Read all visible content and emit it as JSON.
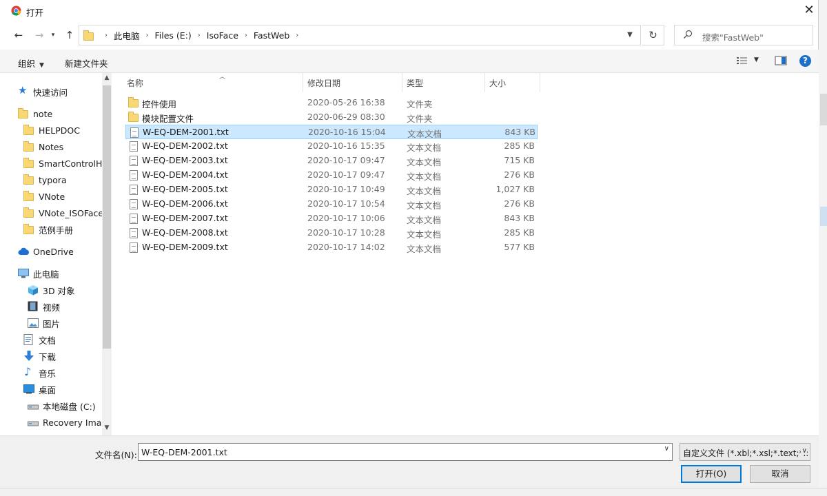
{
  "window": {
    "title": "打开",
    "close_glyph": "✕"
  },
  "address": {
    "crumbs": [
      "此电脑",
      "Files (E:)",
      "IsoFace",
      "FastWeb"
    ],
    "search_placeholder": "搜索\"FastWeb\""
  },
  "toolbar": {
    "organize": "组织",
    "new_folder": "新建文件夹"
  },
  "nav": {
    "items": [
      {
        "label": "快速访问",
        "icon": "star-icon",
        "indent": 0
      },
      {
        "label": "note",
        "icon": "folder-icon",
        "indent": 0
      },
      {
        "label": "HELPDOC",
        "icon": "folder-icon",
        "indent": 1
      },
      {
        "label": "Notes",
        "icon": "folder-icon",
        "indent": 1
      },
      {
        "label": "SmartControlH",
        "icon": "folder-icon",
        "indent": 1
      },
      {
        "label": "typora",
        "icon": "folder-icon",
        "indent": 1
      },
      {
        "label": "VNote",
        "icon": "folder-icon",
        "indent": 1
      },
      {
        "label": "VNote_ISOFace",
        "icon": "folder-icon",
        "indent": 1
      },
      {
        "label": "范例手册",
        "icon": "folder-icon",
        "indent": 1
      },
      {
        "label": "OneDrive",
        "icon": "cloud-icon",
        "indent": 0
      },
      {
        "label": "此电脑",
        "icon": "computer-icon",
        "indent": 0
      },
      {
        "label": "3D 对象",
        "icon": "cube-icon",
        "indent": 1
      },
      {
        "label": "视频",
        "icon": "film-icon",
        "indent": 1
      },
      {
        "label": "图片",
        "icon": "picture-icon",
        "indent": 1
      },
      {
        "label": "文档",
        "icon": "document-icon",
        "indent": 1
      },
      {
        "label": "下载",
        "icon": "download-arrow-icon",
        "indent": 1
      },
      {
        "label": "音乐",
        "icon": "music-note-icon",
        "indent": 1
      },
      {
        "label": "桌面",
        "icon": "desktop-icon",
        "indent": 1
      },
      {
        "label": "本地磁盘 (C:)",
        "icon": "drive-icon",
        "indent": 1
      },
      {
        "label": "Recovery Imag",
        "icon": "drive-icon",
        "indent": 1
      }
    ]
  },
  "columns": {
    "name": "名称",
    "date": "修改日期",
    "type": "类型",
    "size": "大小"
  },
  "files": [
    {
      "name": "控件使用",
      "date": "2020-05-26 16:38",
      "type": "文件夹",
      "size": "",
      "kind": "folder"
    },
    {
      "name": "模块配置文件",
      "date": "2020-06-29 08:30",
      "type": "文件夹",
      "size": "",
      "kind": "folder"
    },
    {
      "name": "W-EQ-DEM-2001.txt",
      "date": "2020-10-16 15:04",
      "type": "文本文档",
      "size": "843 KB",
      "kind": "doc",
      "selected": true
    },
    {
      "name": "W-EQ-DEM-2002.txt",
      "date": "2020-10-16 15:35",
      "type": "文本文档",
      "size": "285 KB",
      "kind": "doc"
    },
    {
      "name": "W-EQ-DEM-2003.txt",
      "date": "2020-10-17 09:47",
      "type": "文本文档",
      "size": "715 KB",
      "kind": "doc"
    },
    {
      "name": "W-EQ-DEM-2004.txt",
      "date": "2020-10-17 09:47",
      "type": "文本文档",
      "size": "276 KB",
      "kind": "doc"
    },
    {
      "name": "W-EQ-DEM-2005.txt",
      "date": "2020-10-17 10:49",
      "type": "文本文档",
      "size": "1,027 KB",
      "kind": "doc"
    },
    {
      "name": "W-EQ-DEM-2006.txt",
      "date": "2020-10-17 10:54",
      "type": "文本文档",
      "size": "276 KB",
      "kind": "doc"
    },
    {
      "name": "W-EQ-DEM-2007.txt",
      "date": "2020-10-17 10:06",
      "type": "文本文档",
      "size": "843 KB",
      "kind": "doc"
    },
    {
      "name": "W-EQ-DEM-2008.txt",
      "date": "2020-10-17 10:28",
      "type": "文本文档",
      "size": "285 KB",
      "kind": "doc"
    },
    {
      "name": "W-EQ-DEM-2009.txt",
      "date": "2020-10-17 14:02",
      "type": "文本文档",
      "size": "577 KB",
      "kind": "doc"
    }
  ],
  "footer": {
    "filename_label": "文件名(N):",
    "filename_value": "W-EQ-DEM-2001.txt",
    "filter": "自定义文件 (*.xbl;*.xsl;*.text;*.:",
    "open": "打开(O)",
    "cancel": "取消"
  },
  "colors": {
    "selection_bg": "#cce8ff",
    "selection_border": "#99d1ff",
    "accent": "#0078d7"
  }
}
